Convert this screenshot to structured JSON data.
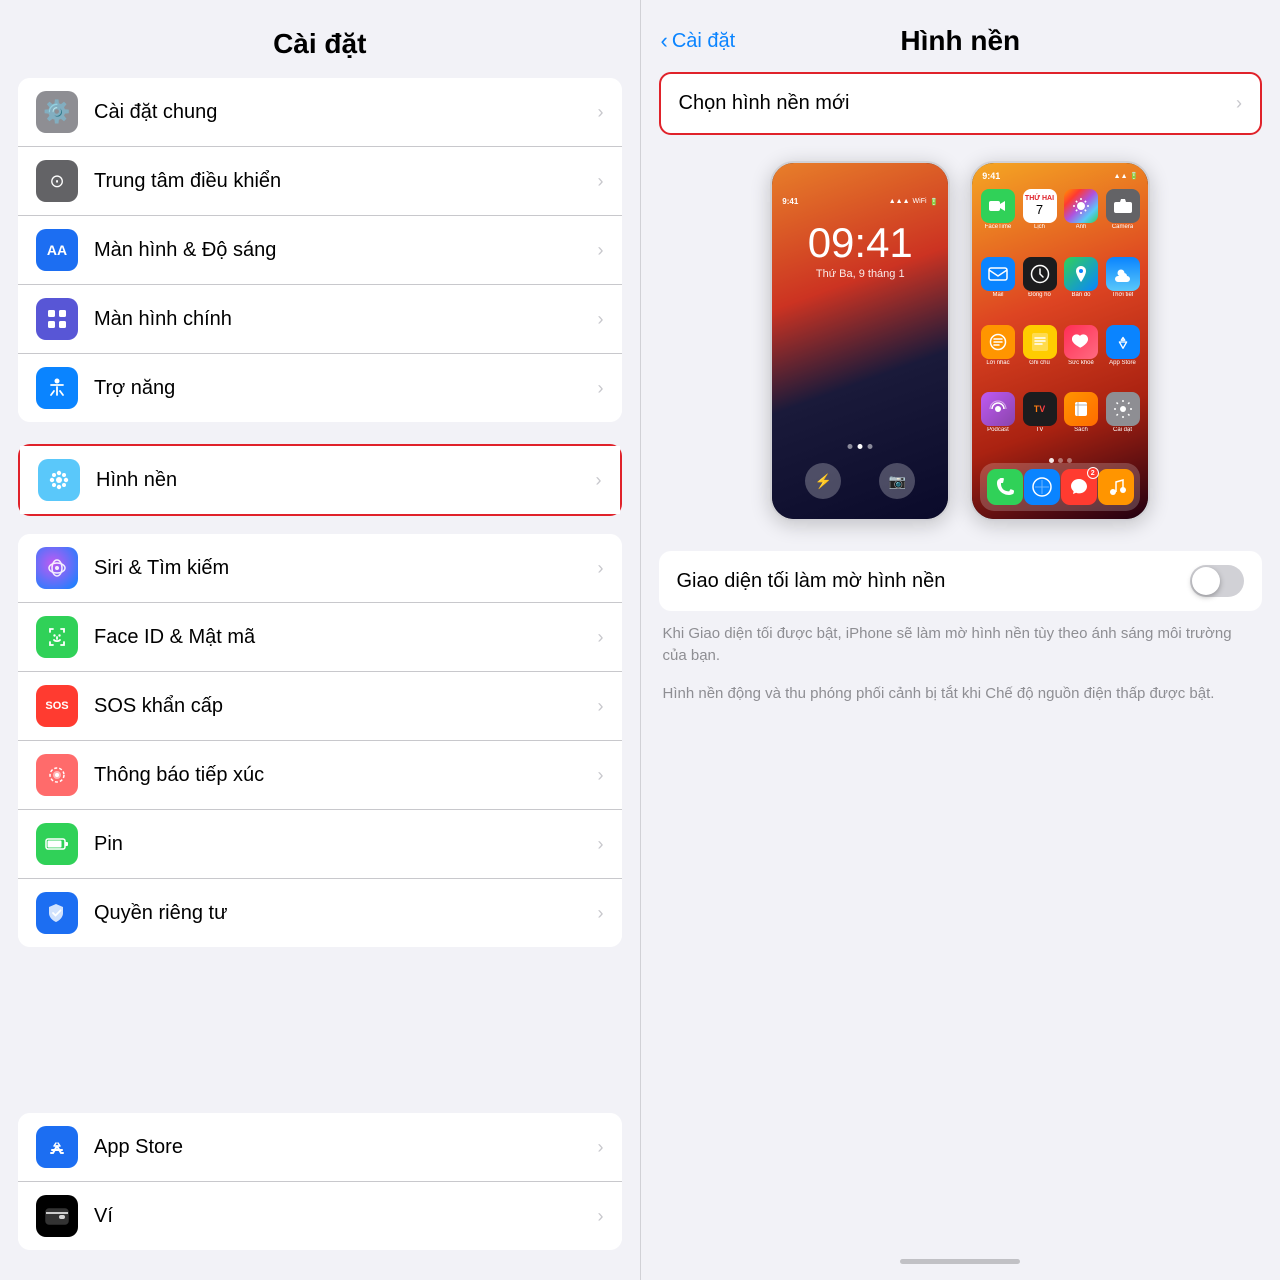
{
  "left": {
    "header": "Cài đặt",
    "group1": [
      {
        "id": "cai-dat-chung",
        "label": "Cài đặt chung",
        "iconBg": "icon-gray",
        "iconChar": "⚙️"
      },
      {
        "id": "trung-tam-dieu-khien",
        "label": "Trung tâm điều khiển",
        "iconBg": "icon-gray2",
        "iconChar": "🎛"
      },
      {
        "id": "man-hinh-do-sang",
        "label": "Màn hình & Độ sáng",
        "iconBg": "icon-blue-aa",
        "iconChar": "AA"
      },
      {
        "id": "man-hinh-chinh",
        "label": "Màn hình chính",
        "iconBg": "icon-purple",
        "iconChar": "⬛"
      },
      {
        "id": "tro-nang",
        "label": "Trợ năng",
        "iconBg": "icon-blue-acc",
        "iconChar": "♿"
      }
    ],
    "highlighted": {
      "id": "hinh-nen",
      "label": "Hình nền",
      "iconBg": "icon-flower",
      "iconChar": "✿"
    },
    "group2": [
      {
        "id": "siri-tim-kiem",
        "label": "Siri & Tìm kiếm",
        "iconBg": "icon-siri",
        "iconChar": "◉"
      },
      {
        "id": "face-id-mat-ma",
        "label": "Face ID & Mật mã",
        "iconBg": "icon-faceid",
        "iconChar": "😊"
      },
      {
        "id": "sos-khan-cap",
        "label": "SOS khẩn cấp",
        "iconBg": "icon-sos",
        "iconChar": "SOS"
      },
      {
        "id": "thong-bao-tiep-xuc",
        "label": "Thông báo tiếp xúc",
        "iconBg": "icon-contact",
        "iconChar": "❋"
      },
      {
        "id": "pin",
        "label": "Pin",
        "iconBg": "icon-battery",
        "iconChar": "🔋"
      },
      {
        "id": "quyen-rieng-tu",
        "label": "Quyền riêng tư",
        "iconBg": "icon-privacy",
        "iconChar": "✋"
      }
    ],
    "group3": [
      {
        "id": "app-store",
        "label": "App Store",
        "iconBg": "icon-appstore",
        "iconChar": "A"
      },
      {
        "id": "vi",
        "label": "Ví",
        "iconBg": "icon-wallet",
        "iconChar": "💳"
      }
    ]
  },
  "right": {
    "back_label": "Cài đặt",
    "title": "Hình nền",
    "choose_label": "Chọn hình nền mới",
    "toggle_label": "Giao diện tối làm mờ hình nền",
    "desc1": "Khi Giao diện tối được bật, iPhone sẽ làm mờ hình nền tùy theo ánh sáng môi trường của bạn.",
    "desc2": "Hình nền động và thu phóng phối cảnh bị tắt khi Chế độ nguồn điện thấp được bật.",
    "lock_time": "09:41",
    "lock_date": "Thứ Ba, 9 tháng 1",
    "home_time": "09:41"
  }
}
